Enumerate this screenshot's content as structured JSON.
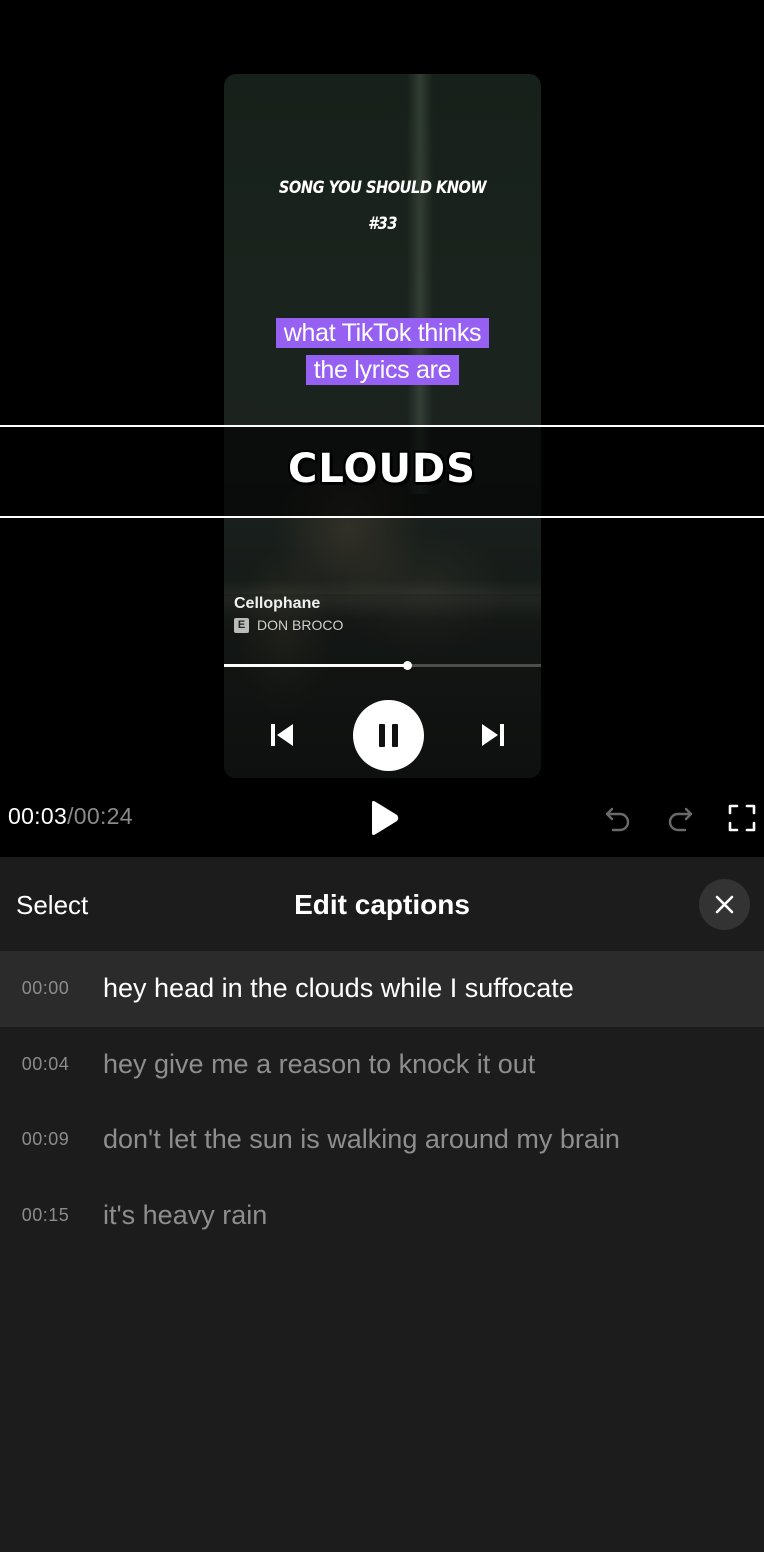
{
  "video": {
    "label_line1": "SONG YOU SHOULD KNOW",
    "label_line2": "#33",
    "sticker_line1": "what TikTok thinks",
    "sticker_line2": "the lyrics are",
    "caption_overlay": "CLOUDS",
    "track_title": "Cellophane",
    "explicit_badge": "E",
    "track_artist": "DON BROCO",
    "progress_fraction": 0.576
  },
  "playback": {
    "current_time": "00:03",
    "separator": "/",
    "total_time": "00:24"
  },
  "panel": {
    "select_label": "Select",
    "title": "Edit captions"
  },
  "captions": [
    {
      "time": "00:00",
      "text": "hey head in the clouds while I suffocate",
      "active": true
    },
    {
      "time": "00:04",
      "text": "hey give me a reason to knock it out",
      "active": false
    },
    {
      "time": "00:09",
      "text": "don't let the sun is walking around my brain",
      "active": false
    },
    {
      "time": "00:15",
      "text": "it's heavy rain",
      "active": false
    }
  ],
  "colors": {
    "sticker_bg": "#9661f2",
    "panel_bg": "#1c1c1c",
    "active_row_bg": "#2b2b2b"
  },
  "icons": [
    "previous-track-icon",
    "pause-icon",
    "next-track-icon",
    "play-icon",
    "undo-icon",
    "redo-icon",
    "fullscreen-icon",
    "close-icon",
    "explicit-icon"
  ]
}
